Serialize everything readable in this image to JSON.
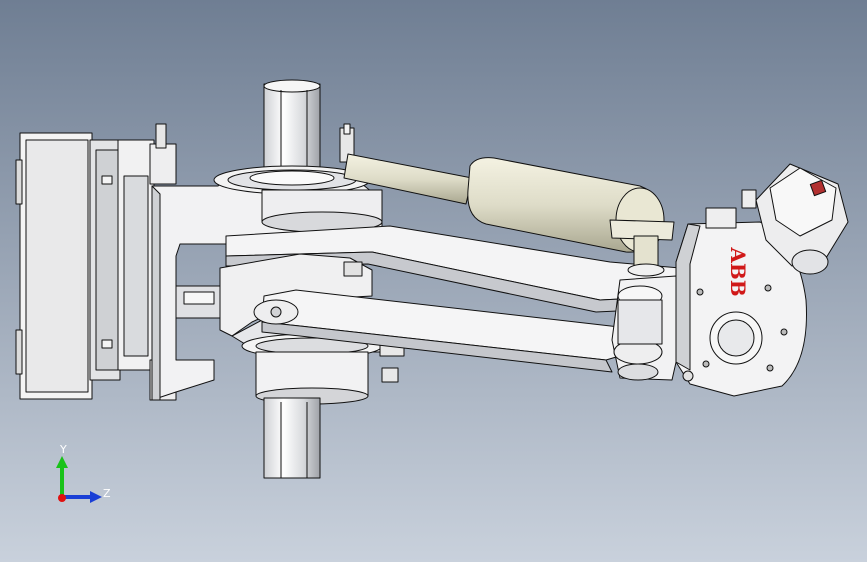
{
  "viewport": {
    "background_top": "#6f7e93",
    "background_bottom": "#c9d1dc"
  },
  "model": {
    "brand": "ABB",
    "brand_color": "#d01818",
    "body_color": "#f2f2f2",
    "shade_color": "#b9bcc2",
    "edge_color": "#111111",
    "cylinder_color": "#dedcc8"
  },
  "triad": {
    "y_label": "Y",
    "z_label": "Z",
    "y_color": "#19c219",
    "z_color": "#1a3fd6",
    "x_color": "#e01010"
  }
}
